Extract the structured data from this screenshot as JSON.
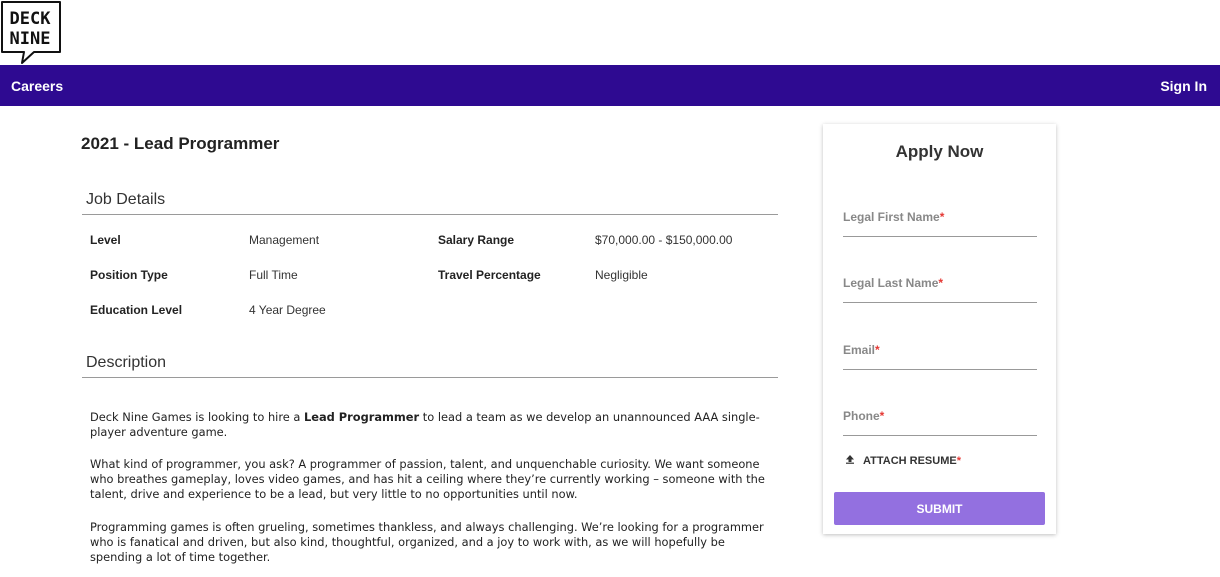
{
  "brand": {
    "logo_line1": "DECK",
    "logo_line2": "NINE"
  },
  "nav": {
    "careers": "Careers",
    "sign_in": "Sign In"
  },
  "job": {
    "title": "2021 - Lead Programmer"
  },
  "sections": {
    "job_details": "Job Details",
    "description": "Description"
  },
  "details": {
    "level_label": "Level",
    "level_value": "Management",
    "salary_label": "Salary Range",
    "salary_value": "$70,000.00 - $150,000.00",
    "position_label": "Position Type",
    "position_value": "Full Time",
    "travel_label": "Travel Percentage",
    "travel_value": "Negligible",
    "education_label": "Education Level",
    "education_value": "4 Year Degree"
  },
  "description": {
    "p1_pre": "Deck Nine Games is looking to hire a ",
    "p1_bold": "Lead Programmer",
    "p1_post": " to lead a team as we develop an unannounced AAA single-player adventure game.",
    "p2": "What kind of programmer, you ask? A programmer of passion, talent, and unquenchable curiosity. We want someone who breathes gameplay, loves video games, and has hit a ceiling where they’re currently working – someone with the talent, drive and experience to be a lead, but very little to no opportunities until now.",
    "p3": "Programming games is often grueling, sometimes thankless, and always challenging. We’re looking for a programmer who is fanatical and driven, but also kind, thoughtful, organized, and a joy to work with, as we will hopefully be spending a lot of time together."
  },
  "apply": {
    "title": "Apply Now",
    "first_name": "Legal First Name",
    "last_name": "Legal Last Name",
    "email": "Email",
    "phone": "Phone",
    "required_mark": "*",
    "attach_resume": "ATTACH RESUME",
    "submit": "SUBMIT"
  },
  "colors": {
    "nav_bg": "#2e0a91",
    "submit_bg": "#9370e0",
    "required": "#e53935"
  },
  "icons": {
    "upload": "upload-icon"
  }
}
